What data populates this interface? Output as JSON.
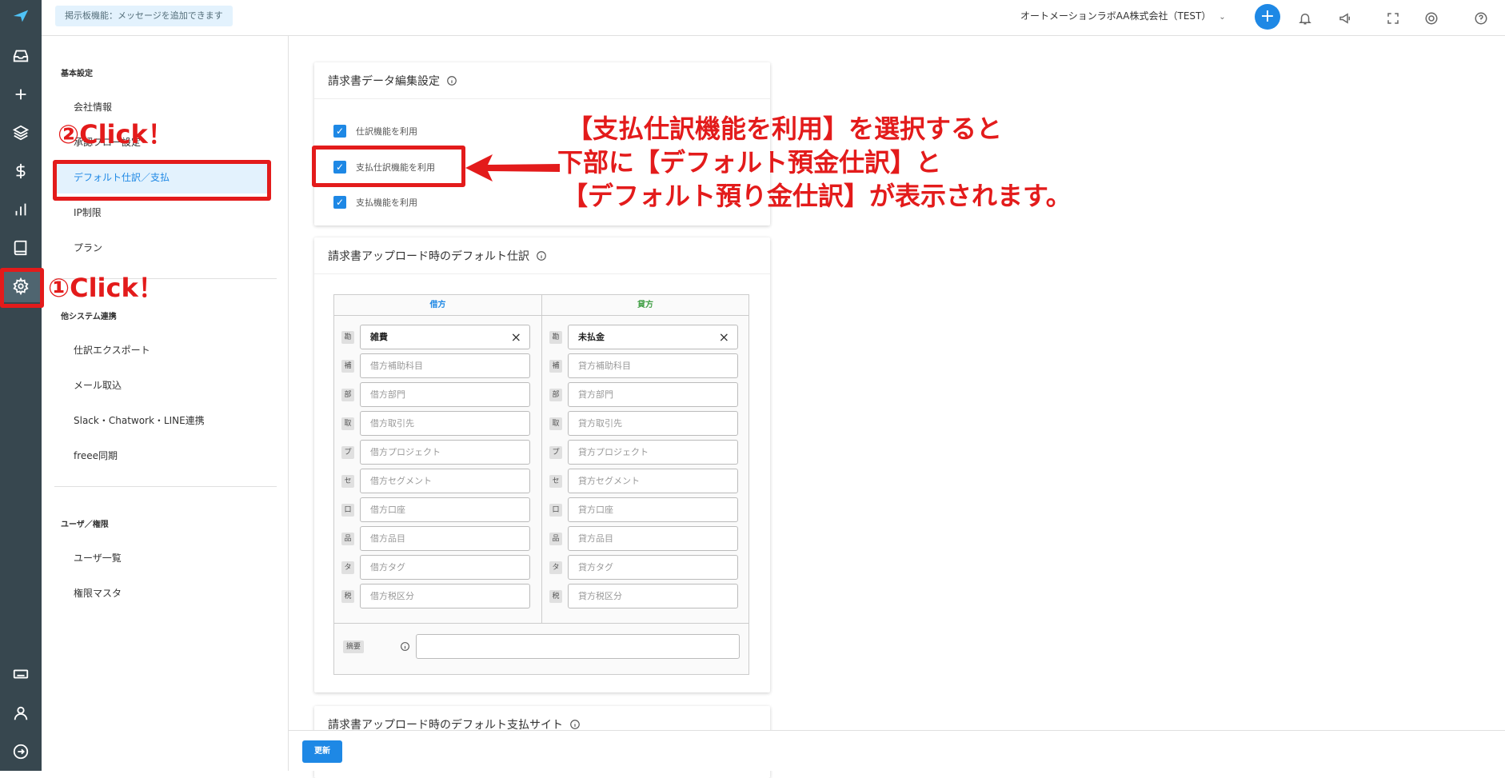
{
  "topbar": {
    "notice": "掲示板機能：メッセージを追加できます",
    "company": "オートメーションラボAA株式会社（TEST）",
    "add_label": "+"
  },
  "settings_nav": {
    "section_basic": "基本設定",
    "item_company": "会社情報",
    "item_approval": "承認フロー設定",
    "item_default_journal": "デフォルト仕訳／支払",
    "item_ip": "IP制限",
    "item_plan": "プラン",
    "section_integration": "他システム連携",
    "item_export": "仕訳エクスポート",
    "item_mail": "メール取込",
    "item_chat": "Slack・Chatwork・LINE連携",
    "item_freee": "freee同期",
    "section_users": "ユーザ／権限",
    "item_user_list": "ユーザ一覧",
    "item_role_master": "権限マスタ"
  },
  "card1": {
    "title": "請求書データ編集設定",
    "opt_journal": "仕訳機能を利用",
    "opt_payment_journal": "支払仕訳機能を利用",
    "opt_payment": "支払機能を利用"
  },
  "card2": {
    "title": "請求書アップロード時のデフォルト仕訳",
    "debit_header": "借方",
    "credit_header": "貸方",
    "tags": [
      "勘",
      "補",
      "部",
      "取",
      "プ",
      "セ",
      "口",
      "品",
      "タ",
      "税"
    ],
    "debit_account": "雑費",
    "credit_account": "未払金",
    "debit_placeholders": [
      "借方補助科目",
      "借方部門",
      "借方取引先",
      "借方プロジェクト",
      "借方セグメント",
      "借方口座",
      "借方品目",
      "借方タグ",
      "借方税区分"
    ],
    "credit_placeholders": [
      "貸方補助科目",
      "貸方部門",
      "貸方取引先",
      "貸方プロジェクト",
      "貸方セグメント",
      "貸方口座",
      "貸方品目",
      "貸方タグ",
      "貸方税区分"
    ],
    "memo_label": "摘要"
  },
  "card3": {
    "title": "請求書アップロード時のデフォルト支払サイト"
  },
  "footer": {
    "update_label": "更新"
  },
  "annotations": {
    "click1": "①Click！",
    "click2": "②Click！",
    "note_line1": "【支払仕訳機能を利用】を選択すると",
    "note_line2": "下部に【デフォルト預金仕訳】と",
    "note_line3": "【デフォルト預り金仕訳】が表示されます。"
  },
  "colors": {
    "rail_bg": "#37474f",
    "accent": "#1e88e5",
    "annotation_red": "#e31b1b"
  }
}
